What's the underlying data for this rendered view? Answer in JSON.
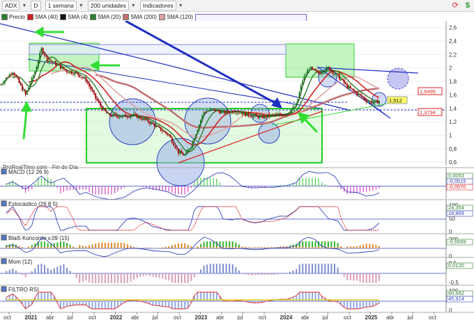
{
  "toolbar": {
    "symbol": "ADX",
    "mode": "D",
    "period": "1 semana",
    "units": "200 unidades",
    "indicators": "Indicadores"
  },
  "legend": {
    "price": "Precio",
    "sma40": "SMA (40)",
    "sma4": "SMA (4)",
    "sma20": "SMA (20)",
    "sma200": "SMA (200)",
    "sma120": "SMA (120)"
  },
  "colors": {
    "candle_up": "#1a7a1a",
    "candle_down": "#b01010",
    "sma40": "#d02020",
    "sma4": "#101010",
    "sma20": "#2e7d2e",
    "sma200": "#c07070",
    "sma120": "#e0a0a0",
    "trend_blue": "#1f2fbf",
    "arrow_green": "#33dd33",
    "box_green": "#90ee90",
    "circle_blue": "#7d8fd6"
  },
  "watermark": "ProRealTime.com - Fin de Día",
  "panels": {
    "macd": "MACD (12 26 9)",
    "stoch": "Estocástico (26 8 5)",
    "blai5": "Blai5 Koncorde v.09 (15)",
    "mom": "Mom (12)",
    "rsi": "FILTRO RSI"
  },
  "price_labels": {
    "last": "1,512",
    "red": "1,3794",
    "pink": "1,6495"
  },
  "indicator_values": {
    "macd_a": "0,0053",
    "macd_b": "-0,0515",
    "macd_c": "-0,0570",
    "stoch_a": "24,354",
    "stoch_b": "18,869",
    "blai5_a": "-0,6569",
    "mom_a": "0,0120",
    "rsi_a": "60,562",
    "rsi_b": "45,914"
  },
  "chart_data": {
    "type": "candlestick",
    "x_labels": [
      "oct",
      "2021",
      "abr",
      "jul",
      "oct",
      "2022",
      "abr",
      "jul",
      "oct",
      "2023",
      "abr",
      "jul",
      "oct",
      "2024",
      "abr",
      "jul",
      "oct",
      "2025",
      "abr",
      "jul",
      "oct"
    ],
    "y_ticks": [
      "2,6",
      "2,4",
      "2,2",
      "2",
      "1,8",
      "1,6",
      "1,4",
      "1,2",
      "1",
      "0,8",
      "0,6"
    ],
    "ylim": [
      0.55,
      2.7
    ],
    "price_path": [
      [
        0,
        1.75
      ],
      [
        4,
        1.95
      ],
      [
        8,
        1.6
      ],
      [
        11,
        1.95
      ],
      [
        13,
        2.28
      ],
      [
        15,
        2.12
      ],
      [
        18,
        2.05
      ],
      [
        21,
        1.95
      ],
      [
        24,
        1.92
      ],
      [
        27,
        1.82
      ],
      [
        30,
        1.55
      ],
      [
        32,
        1.4
      ],
      [
        34,
        1.3
      ],
      [
        38,
        1.28
      ],
      [
        42,
        1.3
      ],
      [
        46,
        1.22
      ],
      [
        50,
        1.1
      ],
      [
        53,
        1.0
      ],
      [
        56,
        0.75
      ],
      [
        58,
        0.7
      ],
      [
        60,
        0.85
      ],
      [
        62,
        1.1
      ],
      [
        64,
        1.35
      ],
      [
        67,
        1.38
      ],
      [
        70,
        1.34
      ],
      [
        74,
        1.36
      ],
      [
        78,
        1.3
      ],
      [
        82,
        1.27
      ],
      [
        86,
        1.3
      ],
      [
        90,
        1.32
      ],
      [
        93,
        1.45
      ],
      [
        95,
        1.82
      ],
      [
        97,
        2.0
      ],
      [
        100,
        1.92
      ],
      [
        103,
        2.0
      ],
      [
        106,
        1.88
      ],
      [
        109,
        1.72
      ],
      [
        112,
        1.62
      ],
      [
        115,
        1.52
      ],
      [
        117,
        1.48
      ],
      [
        119,
        1.51
      ]
    ],
    "x_range": [
      0,
      140
    ],
    "right_axis_extra": {
      "macd_ticks": [
        "0"
      ],
      "stoch_ticks": [
        "100",
        "50",
        "0"
      ],
      "blai5_ticks": [
        "200",
        "0"
      ],
      "mom_ticks": [
        "0,5",
        "-0,5"
      ],
      "rsi_ticks": [
        "100",
        "0"
      ]
    }
  }
}
